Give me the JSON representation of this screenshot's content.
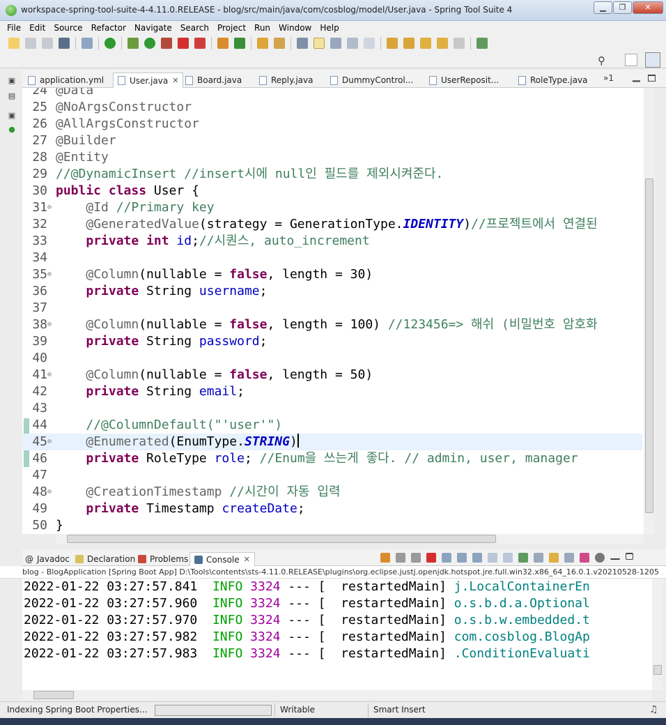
{
  "window": {
    "title": "workspace-spring-tool-suite-4-4.11.0.RELEASE - blog/src/main/java/com/cosblog/model/User.java - Spring Tool Suite 4",
    "minimize": "▁",
    "restore": "❐",
    "close": "✕"
  },
  "menu": [
    "File",
    "Edit",
    "Source",
    "Refactor",
    "Navigate",
    "Search",
    "Project",
    "Run",
    "Window",
    "Help"
  ],
  "editor_tabs": [
    {
      "label": "application.yml",
      "active": false
    },
    {
      "label": "User.java",
      "active": true
    },
    {
      "label": "Board.java",
      "active": false
    },
    {
      "label": "Reply.java",
      "active": false
    },
    {
      "label": "DummyControl...",
      "active": false
    },
    {
      "label": "UserReposit...",
      "active": false
    },
    {
      "label": "RoleType.java",
      "active": false
    }
  ],
  "tab_overflow": "»1",
  "code_lines": [
    {
      "n": "24",
      "parts": [
        [
          "ann",
          "@Data"
        ]
      ]
    },
    {
      "n": "25",
      "parts": [
        [
          "ann",
          "@NoArgsConstructor"
        ]
      ]
    },
    {
      "n": "26",
      "parts": [
        [
          "ann",
          "@AllArgsConstructor"
        ]
      ]
    },
    {
      "n": "27",
      "parts": [
        [
          "ann",
          "@Builder"
        ]
      ]
    },
    {
      "n": "28",
      "parts": [
        [
          "ann",
          "@Entity"
        ]
      ]
    },
    {
      "n": "29",
      "parts": [
        [
          "cm",
          "//@DynamicInsert //insert시에 null인 필드를 제외시켜준다."
        ]
      ]
    },
    {
      "n": "30",
      "parts": [
        [
          "kw",
          "public class"
        ],
        [
          "",
          " User {"
        ]
      ]
    },
    {
      "n": "31",
      "fold": true,
      "parts": [
        [
          "",
          "    "
        ],
        [
          "ann",
          "@Id"
        ],
        [
          "",
          " "
        ],
        [
          "cm",
          "//Primary key"
        ]
      ]
    },
    {
      "n": "32",
      "parts": [
        [
          "",
          "    "
        ],
        [
          "ann",
          "@GeneratedValue"
        ],
        [
          "",
          "(strategy = GenerationType."
        ],
        [
          "cst",
          "IDENTITY"
        ],
        [
          "",
          ")"
        ],
        [
          "cm",
          "//프로젝트에서 연결된"
        ]
      ]
    },
    {
      "n": "33",
      "parts": [
        [
          "",
          "    "
        ],
        [
          "kw",
          "private int"
        ],
        [
          "",
          " "
        ],
        [
          "fld",
          "id"
        ],
        [
          "",
          ";"
        ],
        [
          "cm",
          "//시퀀스, auto_increment"
        ]
      ]
    },
    {
      "n": "34",
      "parts": [
        [
          "",
          ""
        ]
      ]
    },
    {
      "n": "35",
      "fold": true,
      "parts": [
        [
          "",
          "    "
        ],
        [
          "ann",
          "@Column"
        ],
        [
          "",
          "(nullable = "
        ],
        [
          "kw",
          "false"
        ],
        [
          "",
          ", length = 30)"
        ]
      ]
    },
    {
      "n": "36",
      "parts": [
        [
          "",
          "    "
        ],
        [
          "kw",
          "private"
        ],
        [
          "",
          " String "
        ],
        [
          "fld",
          "username"
        ],
        [
          "",
          ";"
        ]
      ]
    },
    {
      "n": "37",
      "parts": [
        [
          "",
          ""
        ]
      ]
    },
    {
      "n": "38",
      "fold": true,
      "parts": [
        [
          "",
          "    "
        ],
        [
          "ann",
          "@Column"
        ],
        [
          "",
          "(nullable = "
        ],
        [
          "kw",
          "false"
        ],
        [
          "",
          ", length = 100) "
        ],
        [
          "cm",
          "//123456=> 해쉬 (비밀번호 암호화"
        ]
      ]
    },
    {
      "n": "39",
      "parts": [
        [
          "",
          "    "
        ],
        [
          "kw",
          "private"
        ],
        [
          "",
          " String "
        ],
        [
          "fld",
          "password"
        ],
        [
          "",
          ";"
        ]
      ]
    },
    {
      "n": "40",
      "parts": [
        [
          "",
          ""
        ]
      ]
    },
    {
      "n": "41",
      "fold": true,
      "parts": [
        [
          "",
          "    "
        ],
        [
          "ann",
          "@Column"
        ],
        [
          "",
          "(nullable = "
        ],
        [
          "kw",
          "false"
        ],
        [
          "",
          ", length = 50)"
        ]
      ]
    },
    {
      "n": "42",
      "parts": [
        [
          "",
          "    "
        ],
        [
          "kw",
          "private"
        ],
        [
          "",
          " String "
        ],
        [
          "fld",
          "email"
        ],
        [
          "",
          ";"
        ]
      ]
    },
    {
      "n": "43",
      "parts": [
        [
          "",
          ""
        ]
      ]
    },
    {
      "n": "44",
      "parts": [
        [
          "",
          "    "
        ],
        [
          "cm",
          "//@ColumnDefault(\"'user'\")"
        ]
      ]
    },
    {
      "n": "45",
      "fold": true,
      "current": true,
      "parts": [
        [
          "",
          "    "
        ],
        [
          "ann",
          "@Enumerated"
        ],
        [
          "",
          "(EnumType."
        ],
        [
          "cst",
          "STRING"
        ],
        [
          "",
          ")"
        ]
      ]
    },
    {
      "n": "46",
      "parts": [
        [
          "",
          "    "
        ],
        [
          "kw",
          "private"
        ],
        [
          "",
          " RoleType "
        ],
        [
          "fld",
          "role"
        ],
        [
          "",
          "; "
        ],
        [
          "cm",
          "//Enum을 쓰는게 좋다. // admin, user, manager"
        ]
      ]
    },
    {
      "n": "47",
      "parts": [
        [
          "",
          ""
        ]
      ]
    },
    {
      "n": "48",
      "fold": true,
      "parts": [
        [
          "",
          "    "
        ],
        [
          "ann",
          "@CreationTimestamp"
        ],
        [
          "",
          " "
        ],
        [
          "cm",
          "//시간이 자동 입력"
        ]
      ]
    },
    {
      "n": "49",
      "parts": [
        [
          "",
          "    "
        ],
        [
          "kw",
          "private"
        ],
        [
          "",
          " Timestamp "
        ],
        [
          "fld",
          "createDate"
        ],
        [
          "",
          ";"
        ]
      ]
    },
    {
      "n": "50",
      "parts": [
        [
          "",
          "}"
        ]
      ]
    }
  ],
  "panel_tabs": [
    {
      "label": "Javadoc",
      "active": false
    },
    {
      "label": "Declaration",
      "active": false
    },
    {
      "label": "Problems",
      "active": false
    },
    {
      "label": "Console",
      "active": true
    }
  ],
  "console_header": "blog - BlogApplication [Spring Boot App] D:\\Tools\\contents\\sts-4.11.0.RELEASE\\plugins\\org.eclipse.justj.openjdk.hotspot.jre.full.win32.x86_64_16.0.1.v20210528-1205",
  "log_lines": [
    {
      "ts": "2022-01-22 03:27:57.841",
      "level": "INFO",
      "pid": "3324",
      "sep": " --- [",
      "thread": "  restartedMain]",
      "logger": " j.LocalContainerEn"
    },
    {
      "ts": "2022-01-22 03:27:57.960",
      "level": "INFO",
      "pid": "3324",
      "sep": " --- [",
      "thread": "  restartedMain]",
      "logger": " o.s.b.d.a.Optional"
    },
    {
      "ts": "2022-01-22 03:27:57.970",
      "level": "INFO",
      "pid": "3324",
      "sep": " --- [",
      "thread": "  restartedMain]",
      "logger": " o.s.b.w.embedded.t"
    },
    {
      "ts": "2022-01-22 03:27:57.982",
      "level": "INFO",
      "pid": "3324",
      "sep": " --- [",
      "thread": "  restartedMain]",
      "logger": " com.cosblog.BlogAp"
    },
    {
      "ts": "2022-01-22 03:27:57.983",
      "level": "INFO",
      "pid": "3324",
      "sep": " --- [",
      "thread": "  restartedMain]",
      "logger": " .ConditionEvaluati"
    }
  ],
  "status": {
    "task": "Indexing Spring Boot Properties...",
    "progress": 0.0,
    "writable": "Writable",
    "insert_mode": "Smart Insert"
  }
}
